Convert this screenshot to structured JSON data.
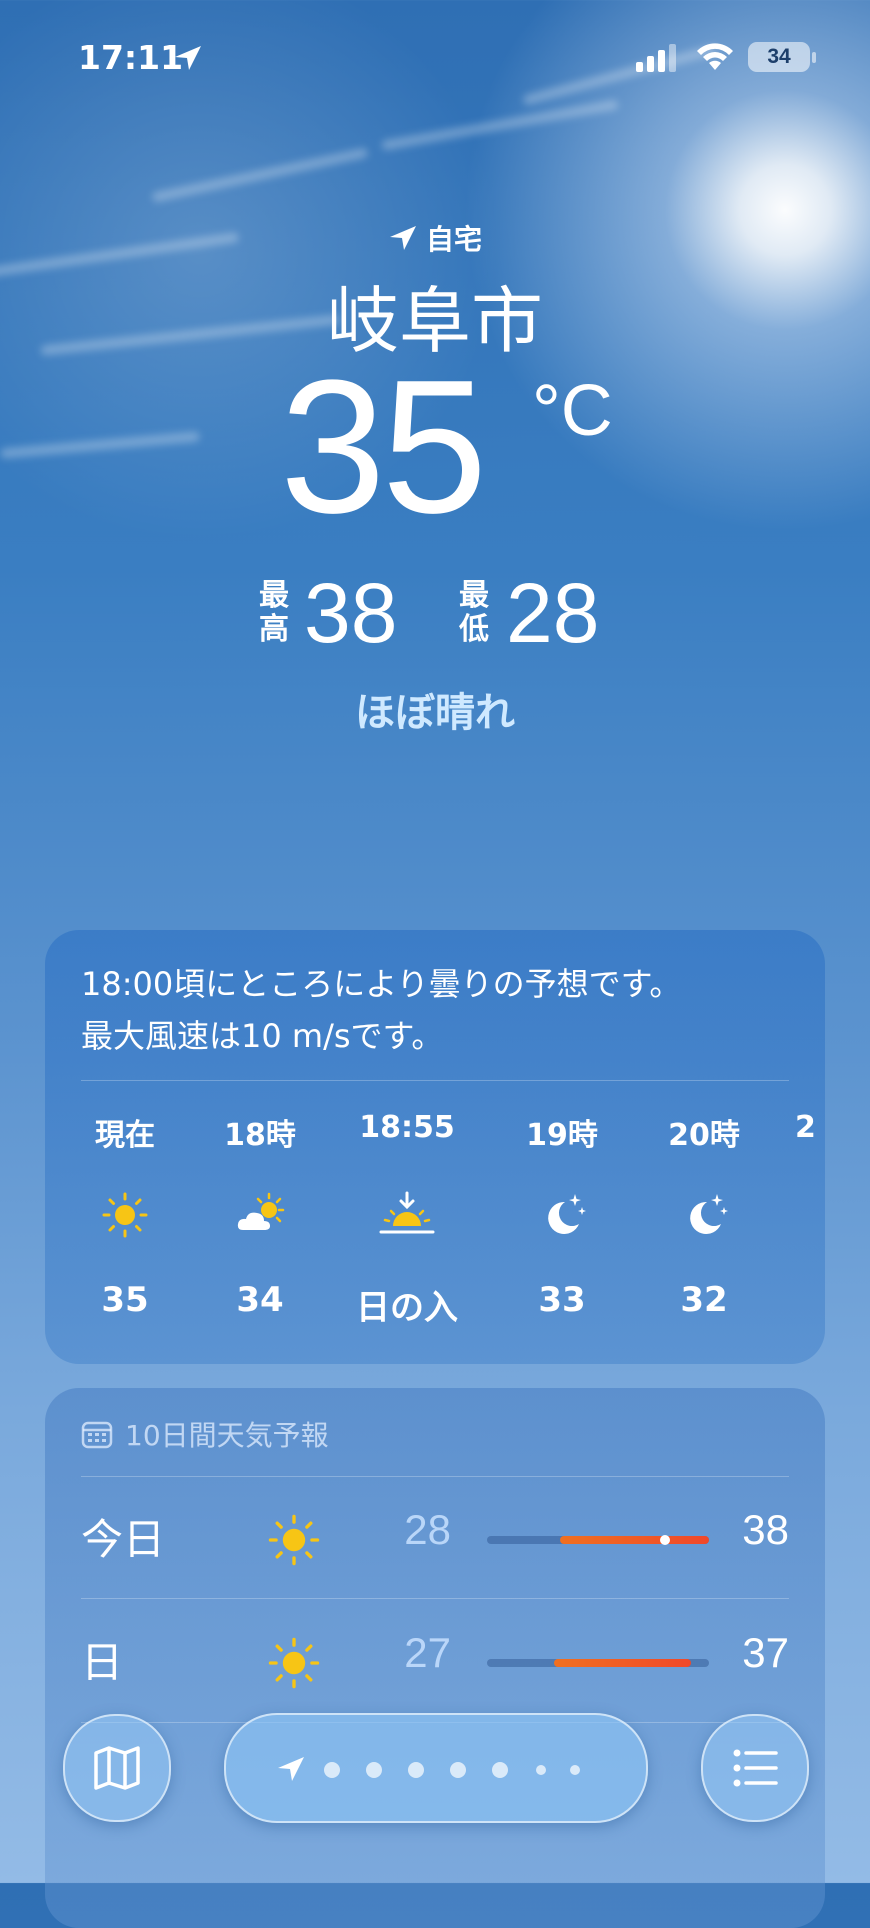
{
  "status_bar": {
    "time": "17:11",
    "battery": "34"
  },
  "header": {
    "home_label": "自宅",
    "city": "岐阜市",
    "temperature": "35",
    "unit": "°C",
    "high_label": [
      "最",
      "高"
    ],
    "high": "38",
    "low_label": [
      "最",
      "低"
    ],
    "low": "28",
    "condition": "ほぼ晴れ"
  },
  "hourly": {
    "summary_line1": "18:00頃にところにより曇りの予想です。",
    "summary_line2": "最大風速は10 m/sです。",
    "items": [
      {
        "label": "現在",
        "icon": "sun-icon",
        "value": "35"
      },
      {
        "label": "18時",
        "icon": "partly-cloudy-icon",
        "value": "34"
      },
      {
        "label": "18:55",
        "icon": "sunset-icon",
        "value": "日の入"
      },
      {
        "label": "19時",
        "icon": "moon-stars-icon",
        "value": "33"
      },
      {
        "label": "20時",
        "icon": "moon-stars-icon",
        "value": "32"
      },
      {
        "label": "2",
        "icon": "",
        "value": ""
      }
    ]
  },
  "daily": {
    "title": "10日間天気予報",
    "rows": [
      {
        "day": "今日",
        "icon": "sun-icon",
        "low": "28",
        "high": "38",
        "bar_start": 0.33,
        "bar_end": 1.0,
        "current": 0.8
      },
      {
        "day": "日",
        "icon": "sun-icon",
        "low": "27",
        "high": "37",
        "bar_start": 0.3,
        "bar_end": 0.92
      }
    ]
  },
  "toolbar": {
    "map": "map-icon",
    "list": "list-icon",
    "location": "location-arrow-icon"
  },
  "colors": {
    "accent_condition": "#cfe9ff",
    "bar_warm": "#f0482a",
    "sun_yellow": "#f7c515"
  }
}
